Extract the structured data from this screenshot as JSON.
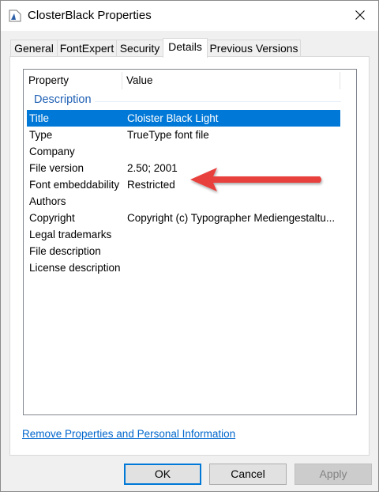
{
  "window": {
    "title": "ClosterBlack Properties"
  },
  "tabs": [
    {
      "label": "General"
    },
    {
      "label": "FontExpert"
    },
    {
      "label": "Security"
    },
    {
      "label": "Details"
    },
    {
      "label": "Previous Versions"
    }
  ],
  "columns": {
    "property": "Property",
    "value": "Value"
  },
  "group": "Description",
  "rows": [
    {
      "property": "Title",
      "value": "Cloister Black Light"
    },
    {
      "property": "Type",
      "value": "TrueType font file"
    },
    {
      "property": "Company",
      "value": ""
    },
    {
      "property": "File version",
      "value": "2.50; 2001"
    },
    {
      "property": "Font embeddability",
      "value": "Restricted"
    },
    {
      "property": "Authors",
      "value": ""
    },
    {
      "property": "Copyright",
      "value": "Copyright (c) Typographer Mediengestaltu..."
    },
    {
      "property": "Legal trademarks",
      "value": ""
    },
    {
      "property": "File description",
      "value": ""
    },
    {
      "property": "License description",
      "value": ""
    }
  ],
  "link": "Remove Properties and Personal Information",
  "buttons": {
    "ok": "OK",
    "cancel": "Cancel",
    "apply": "Apply"
  },
  "colors": {
    "selection": "#0078d7",
    "accent_arrow": "#e8413e",
    "link": "#0066cc"
  }
}
